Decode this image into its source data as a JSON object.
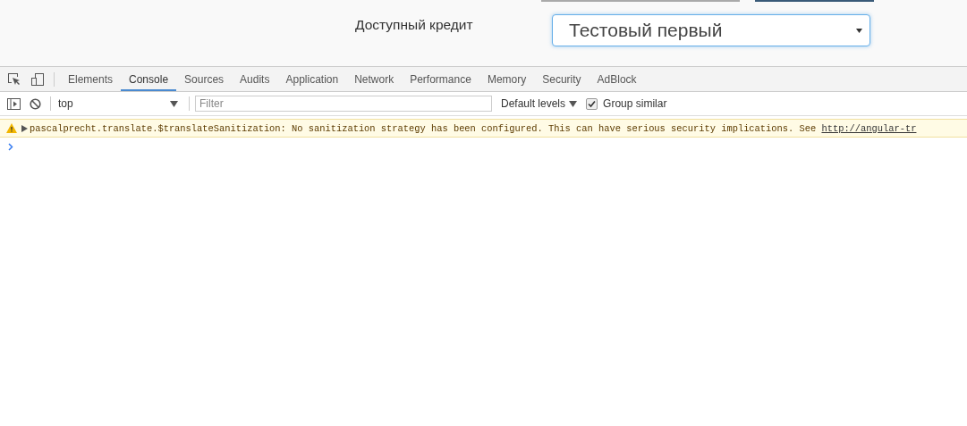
{
  "page": {
    "label": "Доступный кредит",
    "select": {
      "value": "Тестовый первый"
    }
  },
  "devtools": {
    "tabs": [
      {
        "label": "Elements",
        "selected": false
      },
      {
        "label": "Console",
        "selected": true
      },
      {
        "label": "Sources",
        "selected": false
      },
      {
        "label": "Audits",
        "selected": false
      },
      {
        "label": "Application",
        "selected": false
      },
      {
        "label": "Network",
        "selected": false
      },
      {
        "label": "Performance",
        "selected": false
      },
      {
        "label": "Memory",
        "selected": false
      },
      {
        "label": "Security",
        "selected": false
      },
      {
        "label": "AdBlock",
        "selected": false
      }
    ],
    "toolbar": {
      "context": "top",
      "filter": {
        "placeholder": "Filter"
      },
      "levels": "Default levels",
      "group_similar": {
        "label": "Group similar",
        "checked": true
      }
    },
    "messages": [
      {
        "kind": "warning",
        "expanded": false,
        "text": "pascalprecht.translate.$translateSanitization: No sanitization strategy has been configured. This can have serious security implications. See ",
        "link": "http://angular-tr"
      }
    ]
  }
}
